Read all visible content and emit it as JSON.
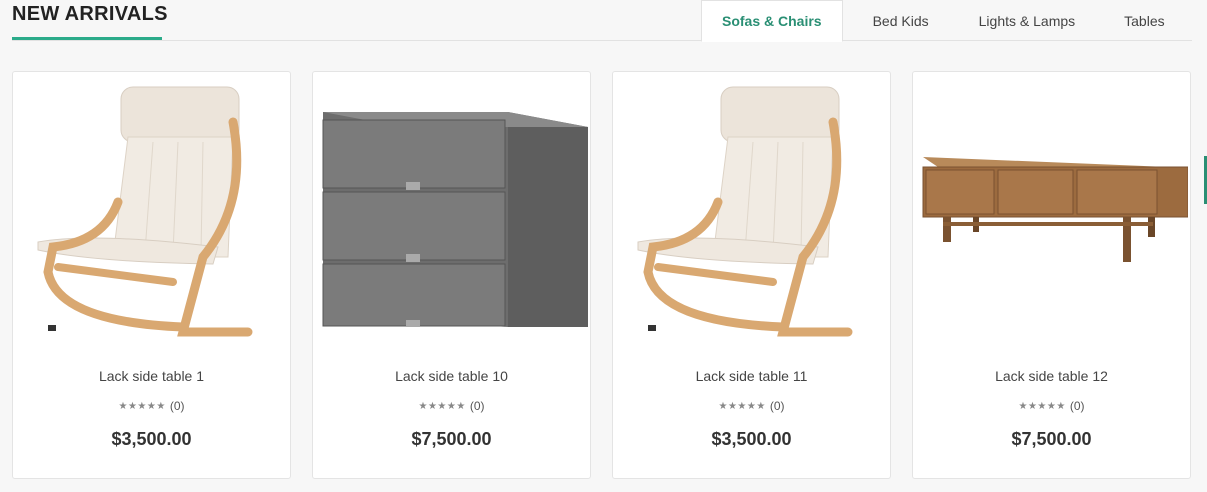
{
  "section": {
    "title": "NEW ARRIVALS"
  },
  "tabs": [
    {
      "label": "Sofas & Chairs",
      "active": true
    },
    {
      "label": "Bed Kids",
      "active": false
    },
    {
      "label": "Lights & Lamps",
      "active": false
    },
    {
      "label": "Tables",
      "active": false
    }
  ],
  "products": [
    {
      "name": "Lack side table 1",
      "rating_count": "(0)",
      "price": "$3,500.00",
      "image": "armchair-image"
    },
    {
      "name": "Lack side table 10",
      "rating_count": "(0)",
      "price": "$7,500.00",
      "image": "drawer-cabinet-image"
    },
    {
      "name": "Lack side table 11",
      "rating_count": "(0)",
      "price": "$3,500.00",
      "image": "armchair-image"
    },
    {
      "name": "Lack side table 12",
      "rating_count": "(0)",
      "price": "$7,500.00",
      "image": "tv-bench-image"
    }
  ],
  "stars": "★★★★★",
  "colors": {
    "accent": "#2bab8a",
    "active_tab_text": "#2a8f74"
  }
}
